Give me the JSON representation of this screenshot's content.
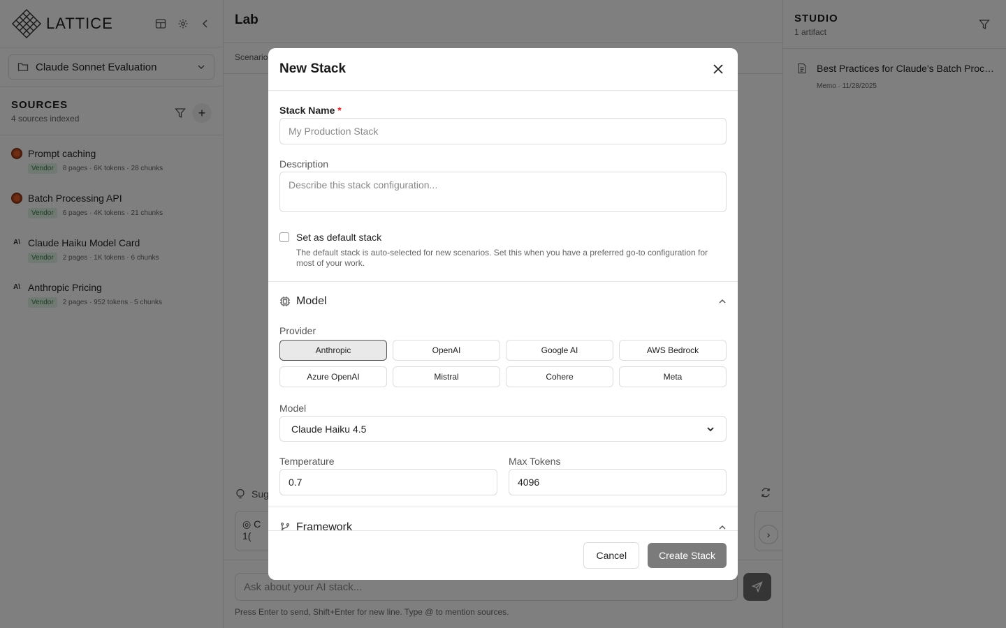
{
  "app": {
    "name": "LATTICE"
  },
  "sidebar": {
    "project": "Claude Sonnet Evaluation",
    "sources_title": "SOURCES",
    "sources_subtitle": "4 sources indexed",
    "sources": [
      {
        "name": "Prompt caching",
        "badge": "Vendor",
        "meta": "8 pages · 6K tokens · 28 chunks",
        "icon": "burst-icon"
      },
      {
        "name": "Batch Processing API",
        "badge": "Vendor",
        "meta": "6 pages · 4K tokens · 21 chunks",
        "icon": "burst-icon"
      },
      {
        "name": "Claude Haiku Model Card",
        "badge": "Vendor",
        "meta": "2 pages · 1K tokens · 6 chunks",
        "icon": "anthropic-icon"
      },
      {
        "name": "Anthropic Pricing",
        "badge": "Vendor",
        "meta": "2 pages · 952 tokens · 5 chunks",
        "icon": "anthropic-icon"
      }
    ]
  },
  "main": {
    "title": "Lab",
    "tab_partial": "Scenario",
    "suggestions_partial": "Sug",
    "sugg_card_line1": "C",
    "sugg_card_line2": "1(",
    "chat_placeholder": "Ask about your AI stack...",
    "hint": "Press Enter to send, Shift+Enter for new line. Type @ to mention sources."
  },
  "studio": {
    "title": "STUDIO",
    "subtitle": "1 artifact",
    "artifacts": [
      {
        "title": "Best Practices for Claude's Batch Processing",
        "meta": "Memo · 11/28/2025"
      }
    ]
  },
  "modal": {
    "title": "New Stack",
    "stack_name_label": "Stack Name",
    "required_mark": "*",
    "stack_name_placeholder": "My Production Stack",
    "description_label": "Description",
    "description_placeholder": "Describe this stack configuration...",
    "default_label": "Set as default stack",
    "default_help": "The default stack is auto-selected for new scenarios. Set this when you have a preferred go-to configuration for most of your work.",
    "model_section": "Model",
    "provider_label": "Provider",
    "providers": [
      "Anthropic",
      "OpenAI",
      "Google AI",
      "AWS Bedrock",
      "Azure OpenAI",
      "Mistral",
      "Cohere",
      "Meta"
    ],
    "selected_provider": "Anthropic",
    "model_label": "Model",
    "model_value": "Claude Haiku 4.5",
    "temperature_label": "Temperature",
    "temperature_value": "0.7",
    "max_tokens_label": "Max Tokens",
    "max_tokens_value": "4096",
    "framework_section": "Framework",
    "cancel": "Cancel",
    "create": "Create Stack"
  },
  "colors": {
    "overlay": "#00000080",
    "selected_provider_bg": "#e9e9e9",
    "create_button": "#7b7b7b",
    "vendor_badge_bg": "#e3f3e6",
    "vendor_badge_text": "#2f7a3e",
    "required": "#dd2222"
  }
}
